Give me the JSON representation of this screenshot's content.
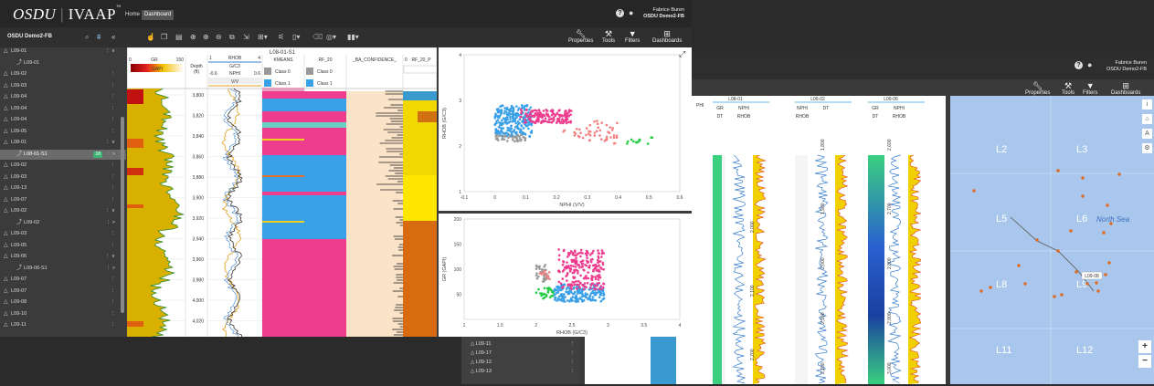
{
  "app": {
    "logo_main": "OSDU",
    "logo_sub": "IVAAP",
    "logo_tm": "™"
  },
  "nav": {
    "home": "Home",
    "dashboard": "Dashboard"
  },
  "user": {
    "name": "Fabrice Buren",
    "project": "OSDU Demo2-FB"
  },
  "toolbar": {
    "project": "OSDU Demo2-FB",
    "properties": "Properties",
    "tools": "Tools",
    "filters": "Filters",
    "dashboards": "Dashboards"
  },
  "sidebar": [
    {
      "name": "L09-01",
      "sub": false,
      "rt": "⋮ ∨"
    },
    {
      "name": "L09-01",
      "sub": true,
      "rt": ""
    },
    {
      "name": "L09-02",
      "sub": false,
      "rt": "⋮"
    },
    {
      "name": "L09-03",
      "sub": false,
      "rt": "⋮"
    },
    {
      "name": "L09-04",
      "sub": false,
      "rt": "⋮"
    },
    {
      "name": "L09-04",
      "sub": false,
      "rt": "⋮"
    },
    {
      "name": "L09-04",
      "sub": false,
      "rt": "⋮"
    },
    {
      "name": "L09-05",
      "sub": false,
      "rt": "⋮"
    },
    {
      "name": "L08-01",
      "sub": false,
      "rt": "⋮ ∨"
    },
    {
      "name": "L08-01-S1",
      "sub": true,
      "rt": "⋮ >",
      "badge": "18",
      "sel": true
    },
    {
      "name": "L09-02",
      "sub": false,
      "rt": "⋮"
    },
    {
      "name": "L09-03",
      "sub": false,
      "rt": "⋮"
    },
    {
      "name": "L09-13",
      "sub": false,
      "rt": "⋮"
    },
    {
      "name": "L09-07",
      "sub": false,
      "rt": "⋮"
    },
    {
      "name": "L09-02",
      "sub": false,
      "rt": "⋮ ∨"
    },
    {
      "name": "L09-02",
      "sub": true,
      "rt": "⋮ >"
    },
    {
      "name": "L09-03",
      "sub": false,
      "rt": "⋮"
    },
    {
      "name": "L09-05",
      "sub": false,
      "rt": "⋮"
    },
    {
      "name": "L09-06",
      "sub": false,
      "rt": "⋮ ∨"
    },
    {
      "name": "L09-06-S1",
      "sub": true,
      "rt": "⋮ >"
    },
    {
      "name": "L09-07",
      "sub": false,
      "rt": "⋮"
    },
    {
      "name": "L09-07",
      "sub": false,
      "rt": "⋮"
    },
    {
      "name": "L09-08",
      "sub": false,
      "rt": "⋮"
    },
    {
      "name": "L09-10",
      "sub": false,
      "rt": "⋮"
    },
    {
      "name": "L09-11",
      "sub": false,
      "rt": "⋮"
    }
  ],
  "back_sidebar": [
    "L09-10",
    "L09-11",
    "L09-17",
    "L09-12",
    "L09-13"
  ],
  "log": {
    "well": "L08-01-S1",
    "gr": {
      "name": "GR",
      "min": "0",
      "max": "150",
      "unit": "GAPI"
    },
    "depth": {
      "name": "Depth",
      "unit": "(ft)"
    },
    "rhob": {
      "name": "RHOB",
      "min": "1",
      "max": "4",
      "unit": "G/C3"
    },
    "nphi": {
      "name": "NPHI",
      "min": "-0.6",
      "max": "0.6",
      "unit": "V/V"
    },
    "kmeans": {
      "name": "KMEANS",
      "classes": [
        "Class 0",
        "Class 1"
      ]
    },
    "rf": {
      "name": "RF_20",
      "classes": [
        "Class 0",
        "Class 1"
      ]
    },
    "conf": {
      "name": "_BA_CONFIDENCE_"
    },
    "rfp": {
      "name": "RF_20_P",
      "min": "0"
    },
    "depths": [
      "3,800",
      "3,820",
      "3,840",
      "3,860",
      "3,880",
      "3,900",
      "3,920",
      "3,940",
      "3,960",
      "3,980",
      "4,000",
      "4,020"
    ]
  },
  "plot1": {
    "xlabel": "NPHI (V/V)",
    "ylabel": "RHOB (G/C3)",
    "xticks": [
      "-0.1",
      "0",
      "0.1",
      "0.2",
      "0.3",
      "0.4",
      "0.5",
      "0.6"
    ],
    "yticks": [
      "1",
      "2",
      "3",
      "4"
    ]
  },
  "plot2": {
    "xlabel": "RHOB (G/C3)",
    "ylabel": "GR (GAPI)",
    "xticks": [
      "1",
      "1.5",
      "2",
      "2.5",
      "3",
      "3.5",
      "4"
    ],
    "yticks": [
      "50",
      "100",
      "150",
      "200"
    ]
  },
  "back_wells": [
    {
      "name": "L08-01",
      "tracks": [
        "GR",
        "NPHI",
        "DT",
        "RHOB"
      ]
    },
    {
      "name": "L09-02",
      "tracks": [
        "NPHI",
        "DT",
        "RHOB"
      ]
    },
    {
      "name": "L09-06",
      "tracks": [
        "GR",
        "NPHI",
        "DT",
        "RHOB"
      ]
    }
  ],
  "back_depths": {
    "well1": [
      "2,000",
      "2,100",
      "2,200"
    ],
    "well2": [
      "1,800",
      "1,900",
      "2,000",
      "2,100",
      "2,200"
    ],
    "well3": [
      "2,600",
      "2,700",
      "2,800",
      "2,900",
      "3,000"
    ]
  },
  "map": {
    "blocks": [
      "L2",
      "L3",
      "L5",
      "L6",
      "L8",
      "L9",
      "L11",
      "L12"
    ],
    "sea": "North Sea",
    "popup": "L09-08",
    "zoom_in": "+",
    "zoom_out": "−"
  },
  "colors": {
    "gr_fill": "#e8d200",
    "kmeans_pink": "#ee3c8e",
    "kmeans_blue": "#3aa0e8",
    "conf_bg": "#fbe3c8",
    "rf_orange": "#e0700f",
    "class0": "#999999",
    "class1": "#3aa0e8"
  }
}
